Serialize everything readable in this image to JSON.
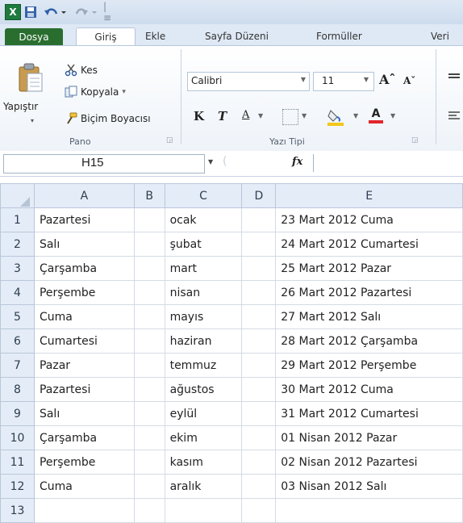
{
  "quick_access": {
    "save_icon": "save-icon",
    "undo_icon": "undo-icon",
    "redo_icon": "redo-icon",
    "customize_glyph": "|≡"
  },
  "tabs": [
    "Dosya",
    "Giriş",
    "Ekle",
    "Sayfa Düzeni",
    "Formüller",
    "Veri"
  ],
  "clipboard": {
    "paste_label": "Yapıştır",
    "cut_label": "Kes",
    "copy_label": "Kopyala",
    "copy_dd": "▾",
    "painter_label": "Biçim Boyacısı",
    "group_label": "Pano"
  },
  "font": {
    "name": "Calibri",
    "size": "11",
    "grow": "Aˆ",
    "shrink": "Aˇ",
    "bold": "K",
    "italic": "T",
    "underline": "A",
    "color_letter": "A",
    "group_label": "Yazı Tipi",
    "colors": {
      "fill": "#f2c81b",
      "font": "#e2262b"
    }
  },
  "formula_bar": {
    "name_box": "H15",
    "fx": "fx",
    "formula": ""
  },
  "columns": [
    "A",
    "B",
    "C",
    "D",
    "E"
  ],
  "rows": [
    {
      "n": "1",
      "a": "Pazartesi",
      "b": "",
      "c": "ocak",
      "d": "",
      "e": "23 Mart 2012 Cuma"
    },
    {
      "n": "2",
      "a": "Salı",
      "b": "",
      "c": "şubat",
      "d": "",
      "e": "24 Mart 2012 Cumartesi"
    },
    {
      "n": "3",
      "a": "Çarşamba",
      "b": "",
      "c": "mart",
      "d": "",
      "e": "25 Mart 2012 Pazar"
    },
    {
      "n": "4",
      "a": "Perşembe",
      "b": "",
      "c": "nisan",
      "d": "",
      "e": "26 Mart 2012 Pazartesi"
    },
    {
      "n": "5",
      "a": "Cuma",
      "b": "",
      "c": "mayıs",
      "d": "",
      "e": "27 Mart 2012 Salı"
    },
    {
      "n": "6",
      "a": "Cumartesi",
      "b": "",
      "c": "haziran",
      "d": "",
      "e": "28 Mart 2012 Çarşamba"
    },
    {
      "n": "7",
      "a": "Pazar",
      "b": "",
      "c": "temmuz",
      "d": "",
      "e": "29 Mart 2012 Perşembe"
    },
    {
      "n": "8",
      "a": "Pazartesi",
      "b": "",
      "c": "ağustos",
      "d": "",
      "e": "30 Mart 2012 Cuma"
    },
    {
      "n": "9",
      "a": "Salı",
      "b": "",
      "c": "eylül",
      "d": "",
      "e": "31 Mart 2012 Cumartesi"
    },
    {
      "n": "10",
      "a": "Çarşamba",
      "b": "",
      "c": "ekim",
      "d": "",
      "e": "01 Nisan 2012 Pazar"
    },
    {
      "n": "11",
      "a": "Perşembe",
      "b": "",
      "c": "kasım",
      "d": "",
      "e": "02 Nisan 2012 Pazartesi"
    },
    {
      "n": "12",
      "a": "Cuma",
      "b": "",
      "c": "aralık",
      "d": "",
      "e": "03 Nisan 2012 Salı"
    },
    {
      "n": "13",
      "a": "",
      "b": "",
      "c": "",
      "d": "",
      "e": ""
    }
  ]
}
